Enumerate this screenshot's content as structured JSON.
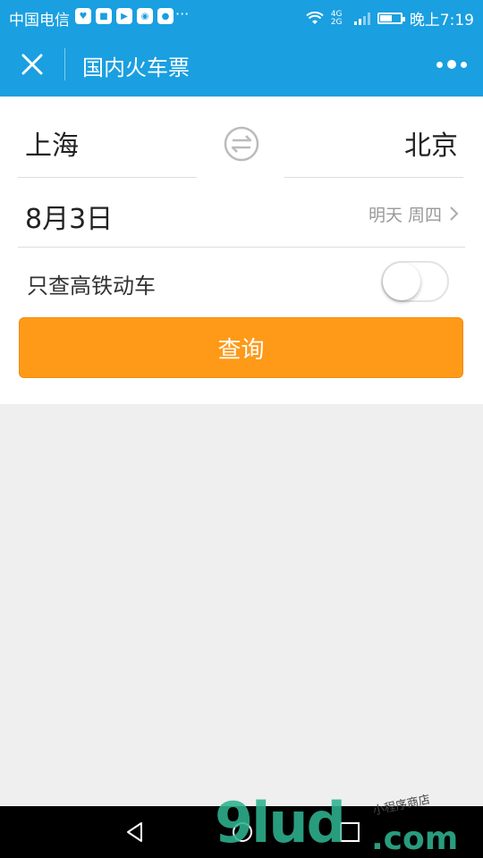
{
  "status_bar": {
    "carrier": "中国电信",
    "app_icons": [
      "heart-icon",
      "toutiao-icon",
      "play-icon",
      "weibo-icon",
      "map-pin-icon"
    ],
    "overflow": "···",
    "network": "4G 2G",
    "time": "晚上7:19"
  },
  "navbar": {
    "title": "国内火车票",
    "close_icon": "close-icon",
    "more_icon": "more-dots-icon"
  },
  "form": {
    "from_city": "上海",
    "to_city": "北京",
    "date": "8月3日",
    "date_hint": "明天 周四",
    "high_speed_label": "只查高铁动车",
    "high_speed_enabled": false,
    "search_label": "查询"
  },
  "watermark": {
    "main": "9lud",
    "suffix": ".com",
    "tag": "小程序商店"
  },
  "colors": {
    "brand_blue": "#1a9fe0",
    "search_orange": "#fe9a17",
    "watermark_green": "#2fb290"
  }
}
